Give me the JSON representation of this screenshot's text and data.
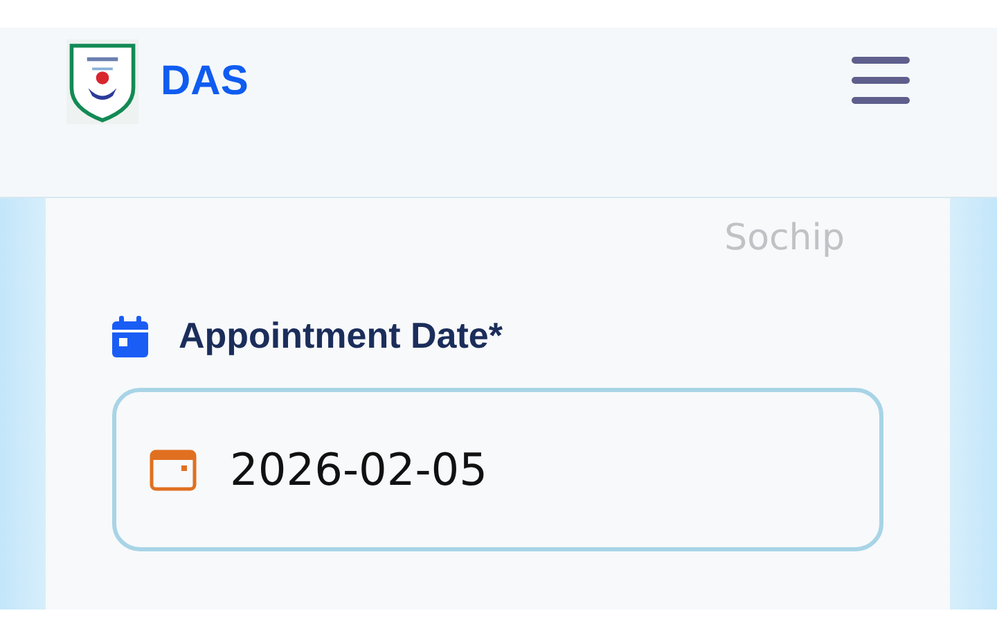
{
  "header": {
    "title": "DAS"
  },
  "card": {
    "partial_text": "Sochip",
    "field": {
      "label": "Appointment Date*",
      "value": "2026-02-05"
    }
  }
}
